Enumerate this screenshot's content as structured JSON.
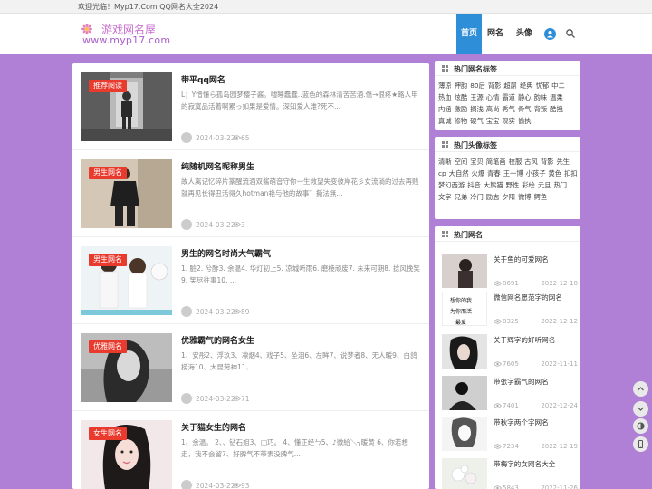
{
  "topbar": {
    "welcome": "欢迎光临！Myp17.Com QQ网名大全2024"
  },
  "logo": {
    "cn": "游戏网名屋",
    "en": "www.myp17.com"
  },
  "nav": [
    {
      "label": "首页"
    },
    {
      "label": "网名"
    },
    {
      "label": "头像"
    }
  ],
  "posts": [
    {
      "badge": "推荐阅读",
      "title": "带平qq网名",
      "excerpt": "L；Y憎懂ら孤岛园梦樱子酱。嘘睡蠢蠢‥蓝色的森林清苦苦酒.傷→很疼★路人甲的寂寞品活着啊累っ如果是爱情。深知爱人难?死不...",
      "date": "2024-03-22",
      "views": "65"
    },
    {
      "badge": "男生网名",
      "title": "纯随机网名昵称男生",
      "excerpt": "故人离记忆碎片篆醒流酒双酱萌音守你一生救望失变彼岸花彡女流淌的过去再贱就再见长得丑活得久hotman艳与他的故事゛撕法無...",
      "date": "2024-03-22",
      "views": "3"
    },
    {
      "badge": "男生网名",
      "title": "男生的网名时尚大气霸气",
      "excerpt": "1. 脏2. 兮酢3. 余温4. 华灯初上5. 凉城听雨6. 磨棱顽废7. 未来可期8. 捻风挽笑9. 笑尽往事10. ...",
      "date": "2024-03-22",
      "views": "89"
    },
    {
      "badge": "优雅网名",
      "title": "优雅霸气的网名女生",
      "excerpt": "1、安彤2、浮玖3、凛烟4、戏子5、坠泪6、左眸7、说梦者8、无人暖9、白鸽捞海10、大昆劳神11、...",
      "date": "2024-03-22",
      "views": "71"
    },
    {
      "badge": "女生网名",
      "title": "关于猫女生的网名",
      "excerpt": "1、余温。 2、、钻石姐3、□巧。 4、懂正经ㄣ5、♪微給＼╮暖黄 6、你若想走，我不会留7、好脾气不带表没脾气...",
      "date": "2024-03-22",
      "views": "93"
    }
  ],
  "widgets": {
    "hot_tags": {
      "title": "热门网名标签",
      "tags": [
        "薄凉",
        "押韵",
        "80后",
        "背影",
        "超屌",
        "经典",
        "忧郁",
        "中二",
        "热血",
        "炫酷",
        "王源",
        "心情",
        "霸道",
        "静心",
        "韵味",
        "温柔",
        "内涵",
        "激励",
        "搁浅",
        "高尚",
        "秀气",
        "骨气",
        "背叛",
        "酷拽",
        "真诚",
        "修物",
        "硬气",
        "宝宝",
        "现实",
        "偷执"
      ]
    },
    "avatar_tags": {
      "title": "热门头像标签",
      "tags": [
        "清晰",
        "空间",
        "宝贝",
        "简笔画",
        "校服",
        "古风",
        "背影",
        "先生",
        "cp",
        "大自然",
        "火爆",
        "青春",
        "王一博",
        "小孩子",
        "黄色",
        "扣扣",
        "梦幻西游",
        "抖音",
        "大熊猫",
        "野性",
        "彩绘",
        "元旦",
        "热门",
        "文字",
        "兄弟",
        "冷门",
        "励志",
        "夕阳",
        "微博",
        "鳄鱼"
      ]
    },
    "hot_names": {
      "title": "热门网名",
      "items": [
        {
          "title": "关于鱼的可爱网名",
          "views": "8691",
          "date": "2022-12-10"
        },
        {
          "title": "微信网名愿范字的网名",
          "views": "8325",
          "date": "2022-12-12",
          "thumb_text": [
            "想你的我",
            "为你而活",
            "最爱"
          ]
        },
        {
          "title": "关于辉字的好听网名",
          "views": "7605",
          "date": "2022-11-11"
        },
        {
          "title": "带张字霸气的网名",
          "views": "7401",
          "date": "2022-12-24"
        },
        {
          "title": "带秋字两个字网名",
          "views": "7234",
          "date": "2022-12-19"
        },
        {
          "title": "带梅字的女网名大全",
          "views": "5843",
          "date": "2022-11-26"
        }
      ]
    }
  }
}
